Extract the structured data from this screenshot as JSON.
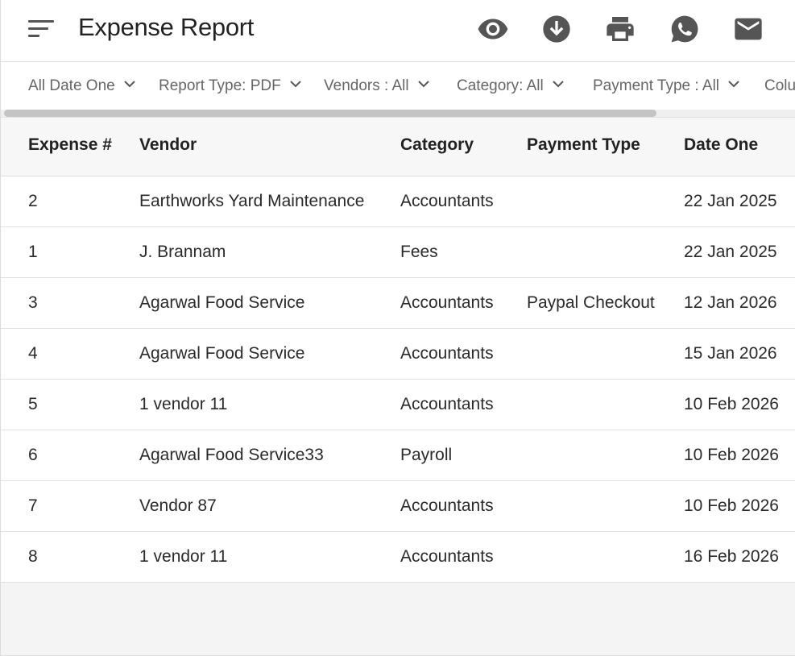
{
  "header": {
    "title": "Expense Report",
    "icons": [
      "menu-icon",
      "eye-icon",
      "download-icon",
      "print-icon",
      "whatsapp-icon",
      "mail-icon"
    ]
  },
  "filters": [
    "All Date One",
    "Report Type: PDF",
    "Vendors : All",
    "Category: All",
    "Payment Type : All",
    "Colu"
  ],
  "table": {
    "columns": [
      "Expense #",
      "Vendor",
      "Category",
      "Payment Type",
      "Date One"
    ],
    "rows": [
      {
        "expense": "2",
        "vendor": "Earthworks Yard Maintenance",
        "category": "Accountants",
        "payment_type": "",
        "date_one": "22 Jan 2025"
      },
      {
        "expense": "1",
        "vendor": "J. Brannam",
        "category": "Fees",
        "payment_type": "",
        "date_one": "22 Jan 2025"
      },
      {
        "expense": "3",
        "vendor": "Agarwal Food Service",
        "category": "Accountants",
        "payment_type": "Paypal Checkout",
        "date_one": "12 Jan 2026"
      },
      {
        "expense": "4",
        "vendor": "Agarwal Food Service",
        "category": "Accountants",
        "payment_type": "",
        "date_one": "15 Jan 2026"
      },
      {
        "expense": "5",
        "vendor": "1 vendor 11",
        "category": "Accountants",
        "payment_type": "",
        "date_one": "10 Feb 2026"
      },
      {
        "expense": "6",
        "vendor": "Agarwal Food Service33",
        "category": "Payroll",
        "payment_type": "",
        "date_one": "10 Feb 2026"
      },
      {
        "expense": "7",
        "vendor": "Vendor 87",
        "category": "Accountants",
        "payment_type": "",
        "date_one": "10 Feb 2026"
      },
      {
        "expense": "8",
        "vendor": "1 vendor 11",
        "category": "Accountants",
        "payment_type": "",
        "date_one": "16 Feb 2026"
      }
    ]
  },
  "colors": {
    "icon": "#555555",
    "header_bg": "#ffffff",
    "table_header_bg": "#f7f7f7",
    "scroll_thumb": "#c4c4c4"
  }
}
